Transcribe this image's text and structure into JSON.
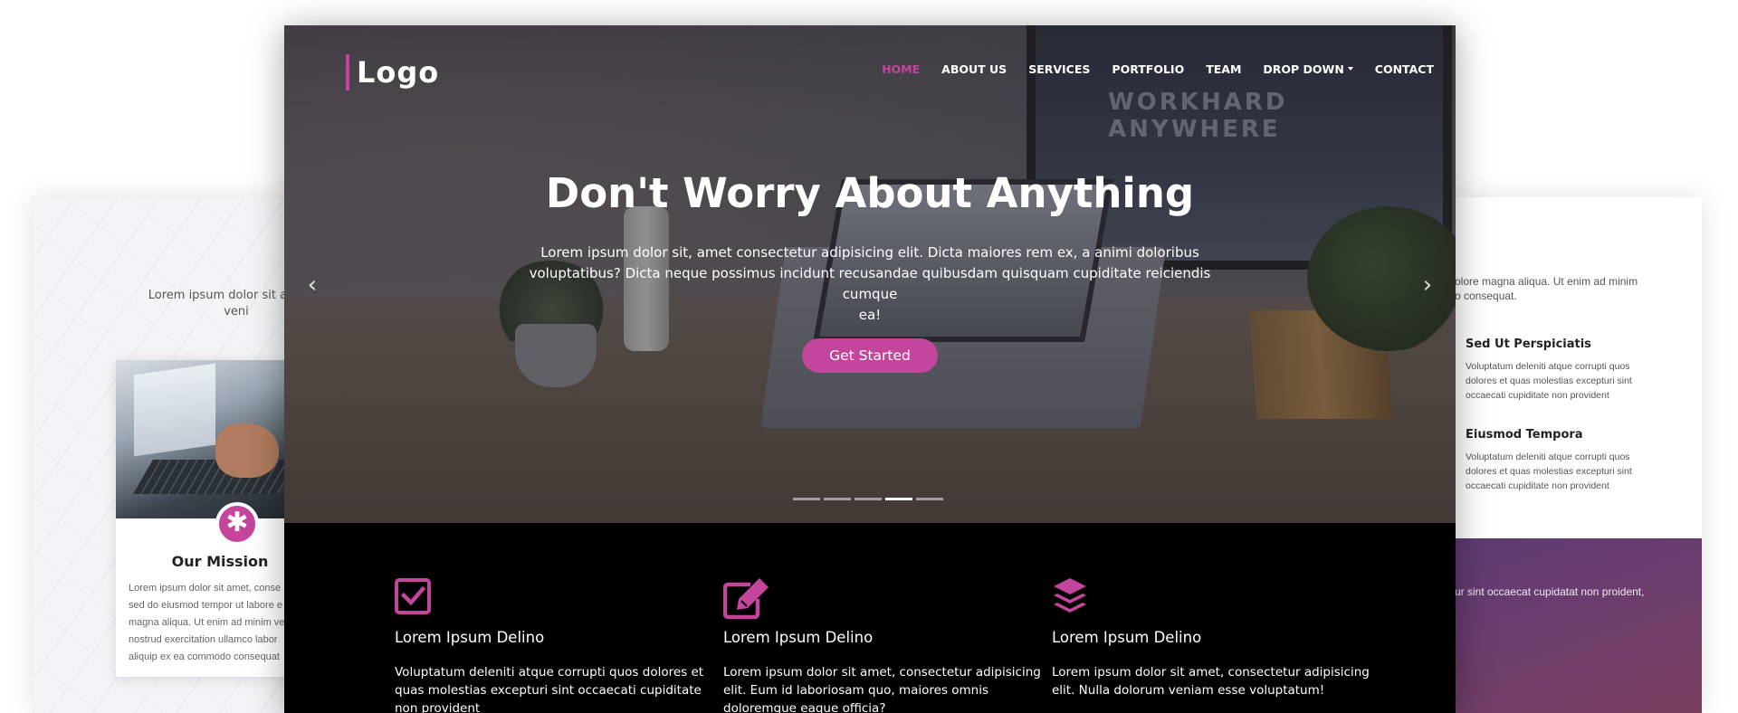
{
  "colors": {
    "accent": "#c4459c",
    "hero_overlay": "#231e26",
    "features_bg": "#000000"
  },
  "left_page": {
    "intro_lines": [
      "Lorem ipsum dolor sit amet, c",
      "veni"
    ],
    "card": {
      "badge_icon": "asterisk-icon",
      "badge_glyph": "✱",
      "title": "Our Mission",
      "text_lines": [
        "Lorem ipsum dolor sit amet, conse",
        "sed do eiusmod tempor ut labore e",
        "magna aliqua. Ut enim ad minim ve",
        "nostrud exercitation ullamco labor",
        "aliquip ex ea commodo consequat"
      ]
    }
  },
  "right_page": {
    "intro_lines": [
      "olore magna aliqua. Ut enim ad minim",
      "o consequat."
    ],
    "items": [
      {
        "title": "Sed Ut Perspiciatis",
        "lines": [
          "Voluptatum deleniti atque corrupti quos",
          "dolores et quas molestias excepturi sint",
          "occaecati cupiditate non provident"
        ]
      },
      {
        "title": "Eiusmod Tempora",
        "lines": [
          "Voluptatum deleniti atque corrupti quos",
          "dolores et quas molestias excepturi sint",
          "occaecati cupiditate non provident"
        ]
      }
    ],
    "band_text": "ur sint occaecat cupidatat non proident,"
  },
  "nav": {
    "logo": "Logo",
    "items": [
      {
        "label": "Home",
        "active": true
      },
      {
        "label": "About Us"
      },
      {
        "label": "Services"
      },
      {
        "label": "Portfolio"
      },
      {
        "label": "Team"
      },
      {
        "label": "Drop Down",
        "dropdown": true
      },
      {
        "label": "Contact"
      }
    ]
  },
  "hero": {
    "title": "Don't Worry About Anything",
    "text_lines": [
      "Lorem ipsum dolor sit, amet consectetur adipisicing elit. Dicta maiores rem ex, a animi doloribus",
      "voluptatibus? Dicta neque possimus incidunt recusandae quibusdam quisquam cupiditate reiciendis cumque",
      "ea!"
    ],
    "cta_label": "Get Started",
    "prev_arrow": "‹",
    "next_arrow": "›",
    "monitor_text_lines": [
      "WORKHARD",
      "ANYWHERE"
    ],
    "slides": 5,
    "active_slide": 4
  },
  "features": [
    {
      "icon": "check-square-icon",
      "title": "Lorem Ipsum Delino",
      "lines": [
        "Voluptatum deleniti atque corrupti quos dolores et",
        "quas molestias excepturi sint occaecati cupiditate",
        "non provident"
      ]
    },
    {
      "icon": "edit-icon",
      "title": "Lorem Ipsum Delino",
      "lines": [
        "Lorem ipsum dolor sit amet, consectetur adipisicing",
        "elit. Eum id laboriosam quo, maiores omnis",
        "doloremque eaque officia?"
      ]
    },
    {
      "icon": "layers-icon",
      "title": "Lorem Ipsum Delino",
      "lines": [
        "Lorem ipsum dolor sit amet, consectetur adipisicing",
        "elit. Nulla dolorum veniam esse voluptatum!"
      ]
    }
  ]
}
